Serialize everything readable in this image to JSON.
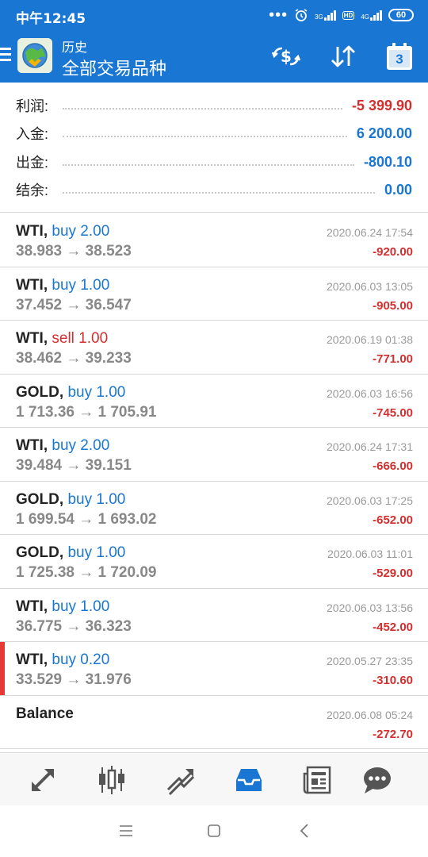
{
  "status_bar": {
    "time": "中午12:45",
    "network_3g": "3G",
    "hd_badge": "HD",
    "network_4g": "4G",
    "battery": "60"
  },
  "app_bar": {
    "section": "历史",
    "filter": "全部交易品种",
    "calendar_day": "3"
  },
  "summary": [
    {
      "label": "利润:",
      "value": "-5 399.90",
      "color": "#d32f2f"
    },
    {
      "label": "入金:",
      "value": "6 200.00",
      "color": "#1976d2"
    },
    {
      "label": "出金:",
      "value": "-800.10",
      "color": "#1976d2"
    },
    {
      "label": "结余:",
      "value": "0.00",
      "color": "#1976d2"
    }
  ],
  "trades": [
    {
      "symbol": "WTI,",
      "side": "buy 2.00",
      "side_color": "#1976d2",
      "prices": "38.983 → 38.523",
      "time": "2020.06.24 17:54",
      "profit": "-920.00"
    },
    {
      "symbol": "WTI,",
      "side": "buy 1.00",
      "side_color": "#1976d2",
      "prices": "37.452 → 36.547",
      "time": "2020.06.03 13:05",
      "profit": "-905.00"
    },
    {
      "symbol": "WTI,",
      "side": "sell 1.00",
      "side_color": "#d32f2f",
      "prices": "38.462 → 39.233",
      "time": "2020.06.19 01:38",
      "profit": "-771.00"
    },
    {
      "symbol": "GOLD,",
      "side": "buy 1.00",
      "side_color": "#1976d2",
      "prices": "1 713.36 → 1 705.91",
      "time": "2020.06.03 16:56",
      "profit": "-745.00"
    },
    {
      "symbol": "WTI,",
      "side": "buy 2.00",
      "side_color": "#1976d2",
      "prices": "39.484 → 39.151",
      "time": "2020.06.24 17:31",
      "profit": "-666.00"
    },
    {
      "symbol": "GOLD,",
      "side": "buy 1.00",
      "side_color": "#1976d2",
      "prices": "1 699.54 → 1 693.02",
      "time": "2020.06.03 17:25",
      "profit": "-652.00"
    },
    {
      "symbol": "GOLD,",
      "side": "buy 1.00",
      "side_color": "#1976d2",
      "prices": "1 725.38 → 1 720.09",
      "time": "2020.06.03 11:01",
      "profit": "-529.00"
    },
    {
      "symbol": "WTI,",
      "side": "buy 1.00",
      "side_color": "#1976d2",
      "prices": "36.775 → 36.323",
      "time": "2020.06.03 13:56",
      "profit": "-452.00"
    },
    {
      "symbol": "WTI,",
      "side": "buy 0.20",
      "side_color": "#1976d2",
      "prices": "33.529 → 31.976",
      "time": "2020.05.27 23:35",
      "profit": "-310.60",
      "highlighted": true
    },
    {
      "symbol": "Balance",
      "side": "",
      "side_color": "#1976d2",
      "prices": "",
      "time": "2020.06.08 05:24",
      "profit": "-272.70"
    }
  ],
  "tabs": [
    {
      "icon": "quotes-icon",
      "active": false
    },
    {
      "icon": "chart-icon",
      "active": false
    },
    {
      "icon": "trade-icon",
      "active": false
    },
    {
      "icon": "history-icon",
      "active": true
    },
    {
      "icon": "news-icon",
      "active": false
    },
    {
      "icon": "messages-icon",
      "active": false
    }
  ],
  "colors": {
    "primary": "#1976d2",
    "loss": "#d32f2f",
    "tab_icon": "#555555",
    "tab_active": "#1976d2"
  }
}
